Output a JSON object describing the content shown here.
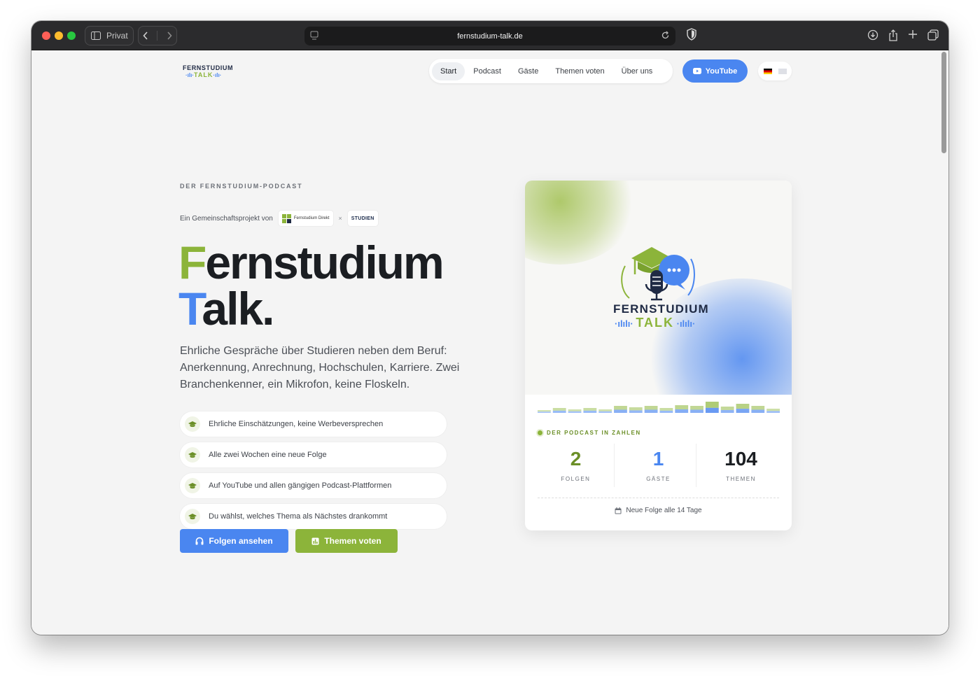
{
  "browser": {
    "mode_label": "Privat",
    "url": "fernstudium-talk.de"
  },
  "site": {
    "logo": {
      "top": "FERNSTUDIUM",
      "bottom": "TALK"
    },
    "nav": [
      {
        "label": "Start",
        "active": true
      },
      {
        "label": "Podcast"
      },
      {
        "label": "Gäste"
      },
      {
        "label": "Themen voten"
      },
      {
        "label": "Über uns"
      }
    ],
    "youtube_label": "YouTube",
    "languages": [
      "de",
      "en"
    ]
  },
  "hero": {
    "eyebrow": "DER FERNSTUDIUM-PODCAST",
    "collab_prefix": "Ein Gemeinschaftsprojekt von",
    "partner_a": "Fernstudium Direkt",
    "partner_sep": "×",
    "partner_b": "STUDIEN",
    "title_line1_first": "F",
    "title_line1_rest": "ernstudium",
    "title_line2_first": "T",
    "title_line2_rest": "alk.",
    "lead": "Ehrliche Gespräche über Studieren neben dem Beruf: Anerkennung, Anrechnung, Hochschulen, Karriere. Zwei Branchenkenner, ein Mikrofon, keine Floskeln.",
    "features": [
      "Ehrliche Einschätzungen, keine Werbeversprechen",
      "Alle zwei Wochen eine neue Folge",
      "Auf YouTube und allen gängigen Podcast-Plattformen",
      "Du wählst, welches Thema als Nächstes drankommt"
    ],
    "cta_primary": "Folgen ansehen",
    "cta_secondary": "Themen voten"
  },
  "card": {
    "logo_top": "FERNSTUDIUM",
    "logo_bottom": "TALK",
    "bar_levels": [
      0.2,
      0.35,
      0.25,
      0.35,
      0.25,
      0.5,
      0.4,
      0.5,
      0.35,
      0.55,
      0.5,
      0.8,
      0.45,
      0.65,
      0.5,
      0.3
    ],
    "stats_title": "DER PODCAST IN ZAHLEN",
    "stats": [
      {
        "value": "2",
        "label": "FOLGEN",
        "color": "#6b8f27"
      },
      {
        "value": "1",
        "label": "GÄSTE",
        "color": "#4a86f0"
      },
      {
        "value": "104",
        "label": "THEMEN",
        "color": "#1b1e22"
      }
    ],
    "footer": "Neue Folge alle 14 Tage"
  },
  "colors": {
    "green": "#8cb43a",
    "blue": "#4a86f0",
    "navy": "#1f2a44"
  }
}
